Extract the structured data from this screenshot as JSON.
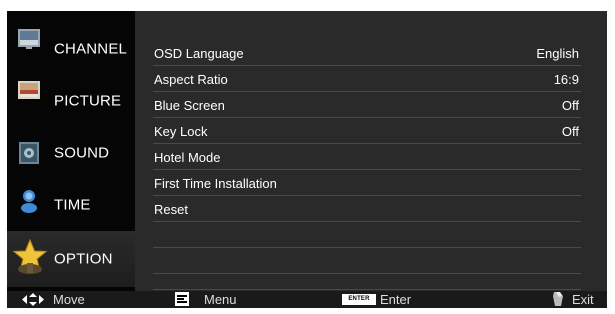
{
  "sidebar": {
    "items": [
      {
        "label": "CHANNEL",
        "icon": "channel-icon"
      },
      {
        "label": "PICTURE",
        "icon": "picture-icon"
      },
      {
        "label": "SOUND",
        "icon": "sound-icon"
      },
      {
        "label": "TIME",
        "icon": "time-icon"
      },
      {
        "label": "OPTION",
        "icon": "option-star-icon",
        "active": true
      }
    ]
  },
  "menu": {
    "rows": [
      {
        "label": "OSD Language",
        "value": "English"
      },
      {
        "label": "Aspect Ratio",
        "value": "16:9"
      },
      {
        "label": "Blue Screen",
        "value": "Off"
      },
      {
        "label": "Key Lock",
        "value": "Off"
      },
      {
        "label": "Hotel Mode",
        "value": ""
      },
      {
        "label": "First Time Installation",
        "value": ""
      },
      {
        "label": "Reset",
        "value": ""
      },
      {
        "label": "",
        "value": ""
      },
      {
        "label": "",
        "value": ""
      },
      {
        "label": "",
        "value": ""
      }
    ]
  },
  "footer": {
    "move": "Move",
    "menu": "Menu",
    "enter_key": "ENTER",
    "enter": "Enter",
    "exit": "Exit"
  },
  "colors": {
    "panel": "#2a2a2a",
    "sidebar": "#050505",
    "divider": "#4a4a4a",
    "text": "#ffffff"
  }
}
